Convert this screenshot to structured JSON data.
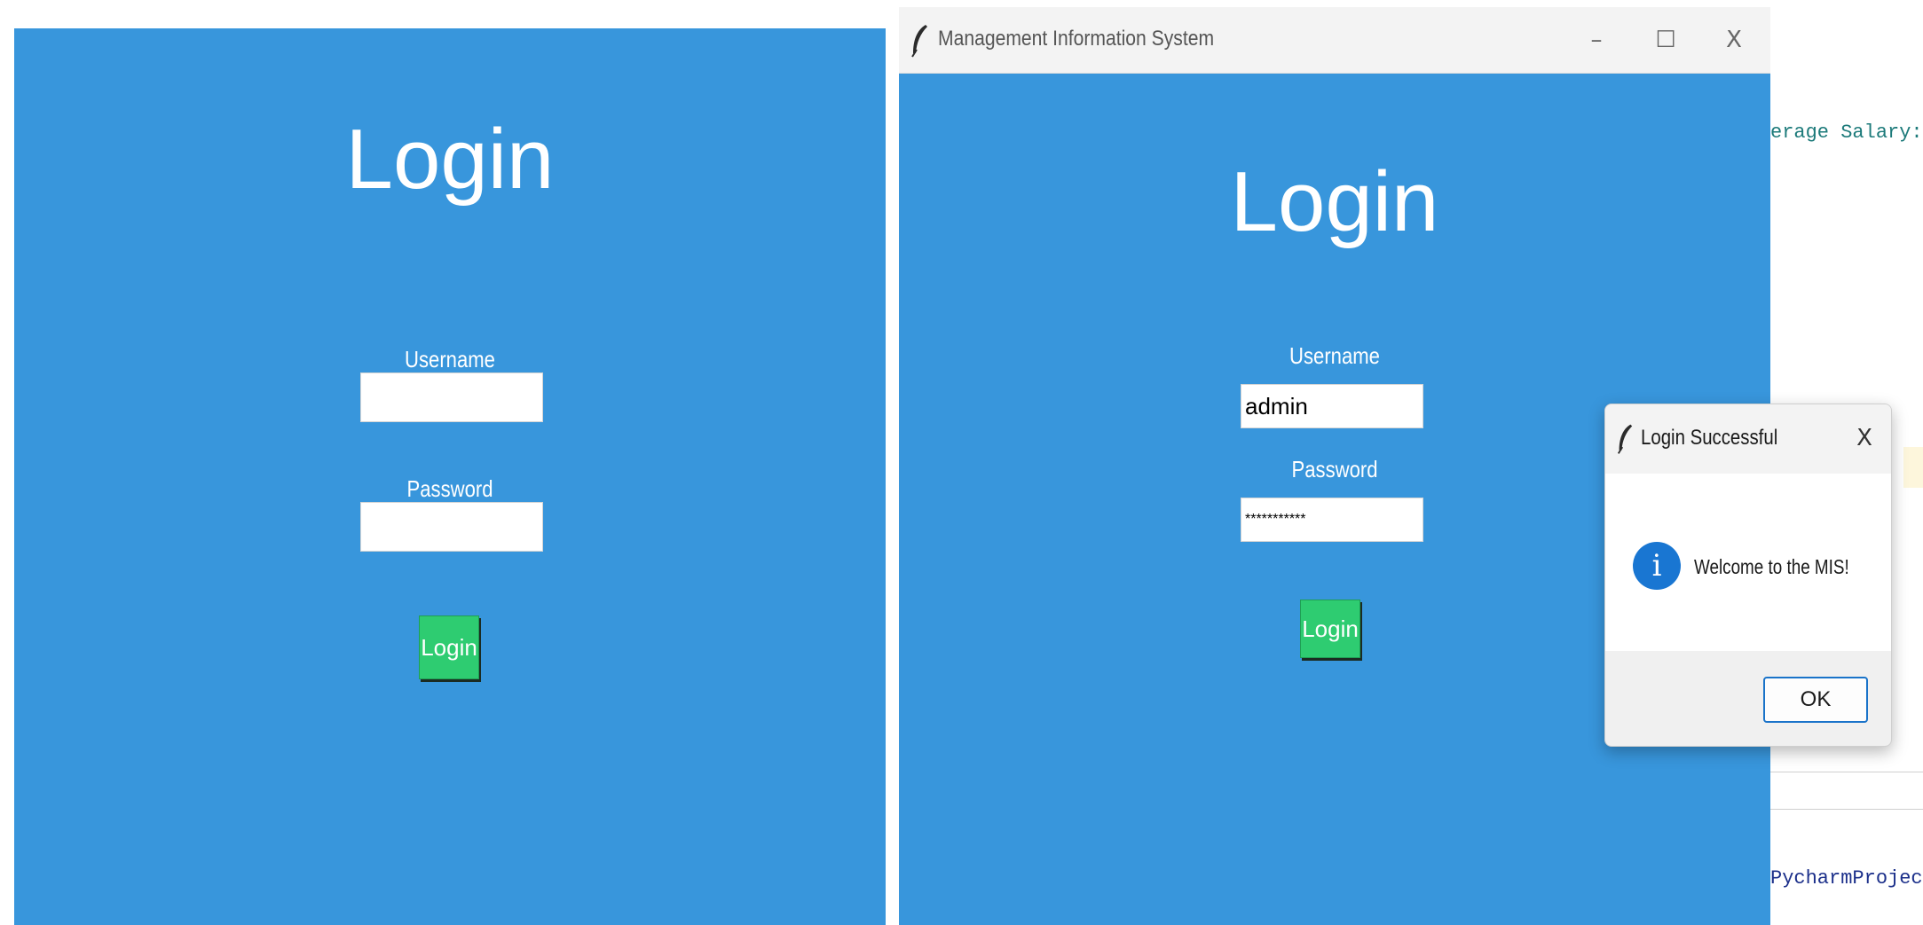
{
  "left_panel": {
    "title": "Login",
    "username_label": "Username",
    "username_value": "",
    "password_label": "Password",
    "password_value": "",
    "login_button": "Login"
  },
  "right_window": {
    "titlebar": {
      "title": "Management Information System",
      "app_icon": "feather-icon",
      "minimize_glyph": "–",
      "maximize_glyph": "☐",
      "close_glyph": "X"
    },
    "title": "Login",
    "username_label": "Username",
    "username_value": "admin",
    "password_label": "Password",
    "password_value": "***********",
    "login_button": "Login"
  },
  "dialog": {
    "title": "Login Successful",
    "app_icon": "feather-icon",
    "close_glyph": "X",
    "info_icon": "info-icon",
    "info_glyph": "i",
    "message": "Welcome to the MIS!",
    "ok_button": "OK"
  },
  "background_ide": {
    "line_top": "erage Salary: $",
    "line_bottom": "PycharmProjects"
  },
  "colors": {
    "window_background": "#3896dc",
    "button_green": "#2ecc71",
    "info_blue": "#1976d2",
    "code_teal": "#1c7a7a",
    "code_navy": "#1b2f8a"
  }
}
